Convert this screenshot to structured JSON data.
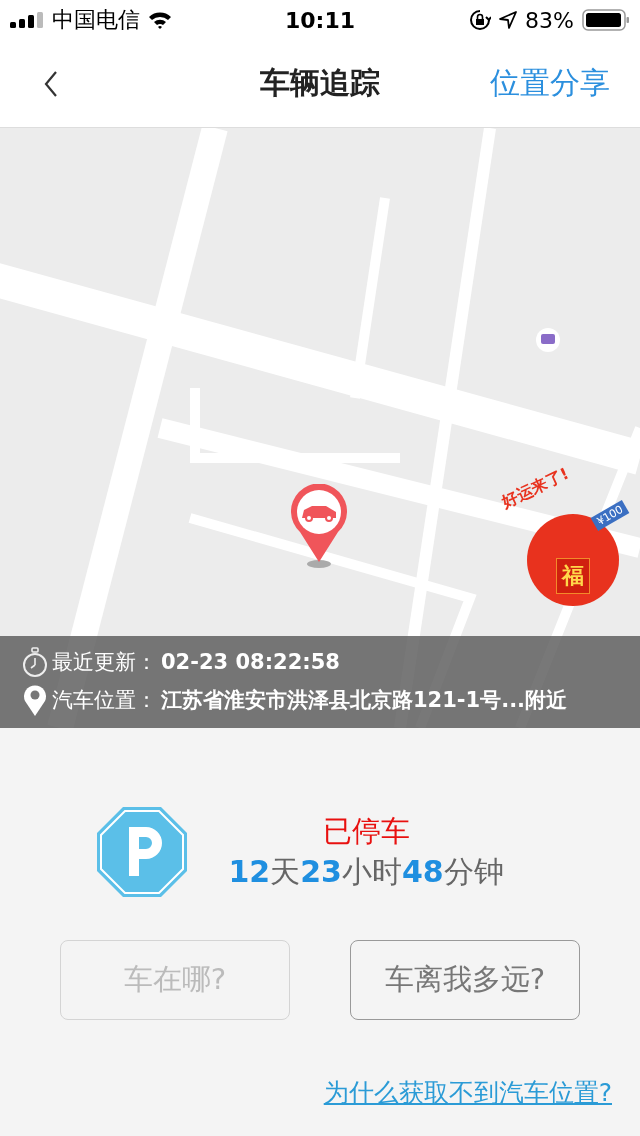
{
  "status_bar": {
    "carrier": "中国电信",
    "time": "10:11",
    "battery": "83%"
  },
  "nav": {
    "title": "车辆追踪",
    "action": "位置分享"
  },
  "map": {
    "promo": {
      "slogan": "好运来了!",
      "amount": "¥100",
      "symbol": "福"
    }
  },
  "info": [
    {
      "kind": "time",
      "label": "最近更新：",
      "value": "02-23 08:22:58"
    },
    {
      "kind": "location",
      "label": "汽车位置：",
      "value": "江苏省淮安市洪泽县北京路121-1号...附近"
    }
  ],
  "parking": {
    "status": "已停车",
    "duration": [
      {
        "kind": "number",
        "text": "12"
      },
      {
        "kind": "unit",
        "text": "天"
      },
      {
        "kind": "number",
        "text": "23"
      },
      {
        "kind": "unit",
        "text": "小时"
      },
      {
        "kind": "number",
        "text": "48"
      },
      {
        "kind": "unit",
        "text": "分钟"
      }
    ]
  },
  "buttons": [
    {
      "label": "车在哪?",
      "disabled": true
    },
    {
      "label": "车离我多远?",
      "disabled": false
    }
  ],
  "help_link": "为什么获取不到汽车位置?"
}
